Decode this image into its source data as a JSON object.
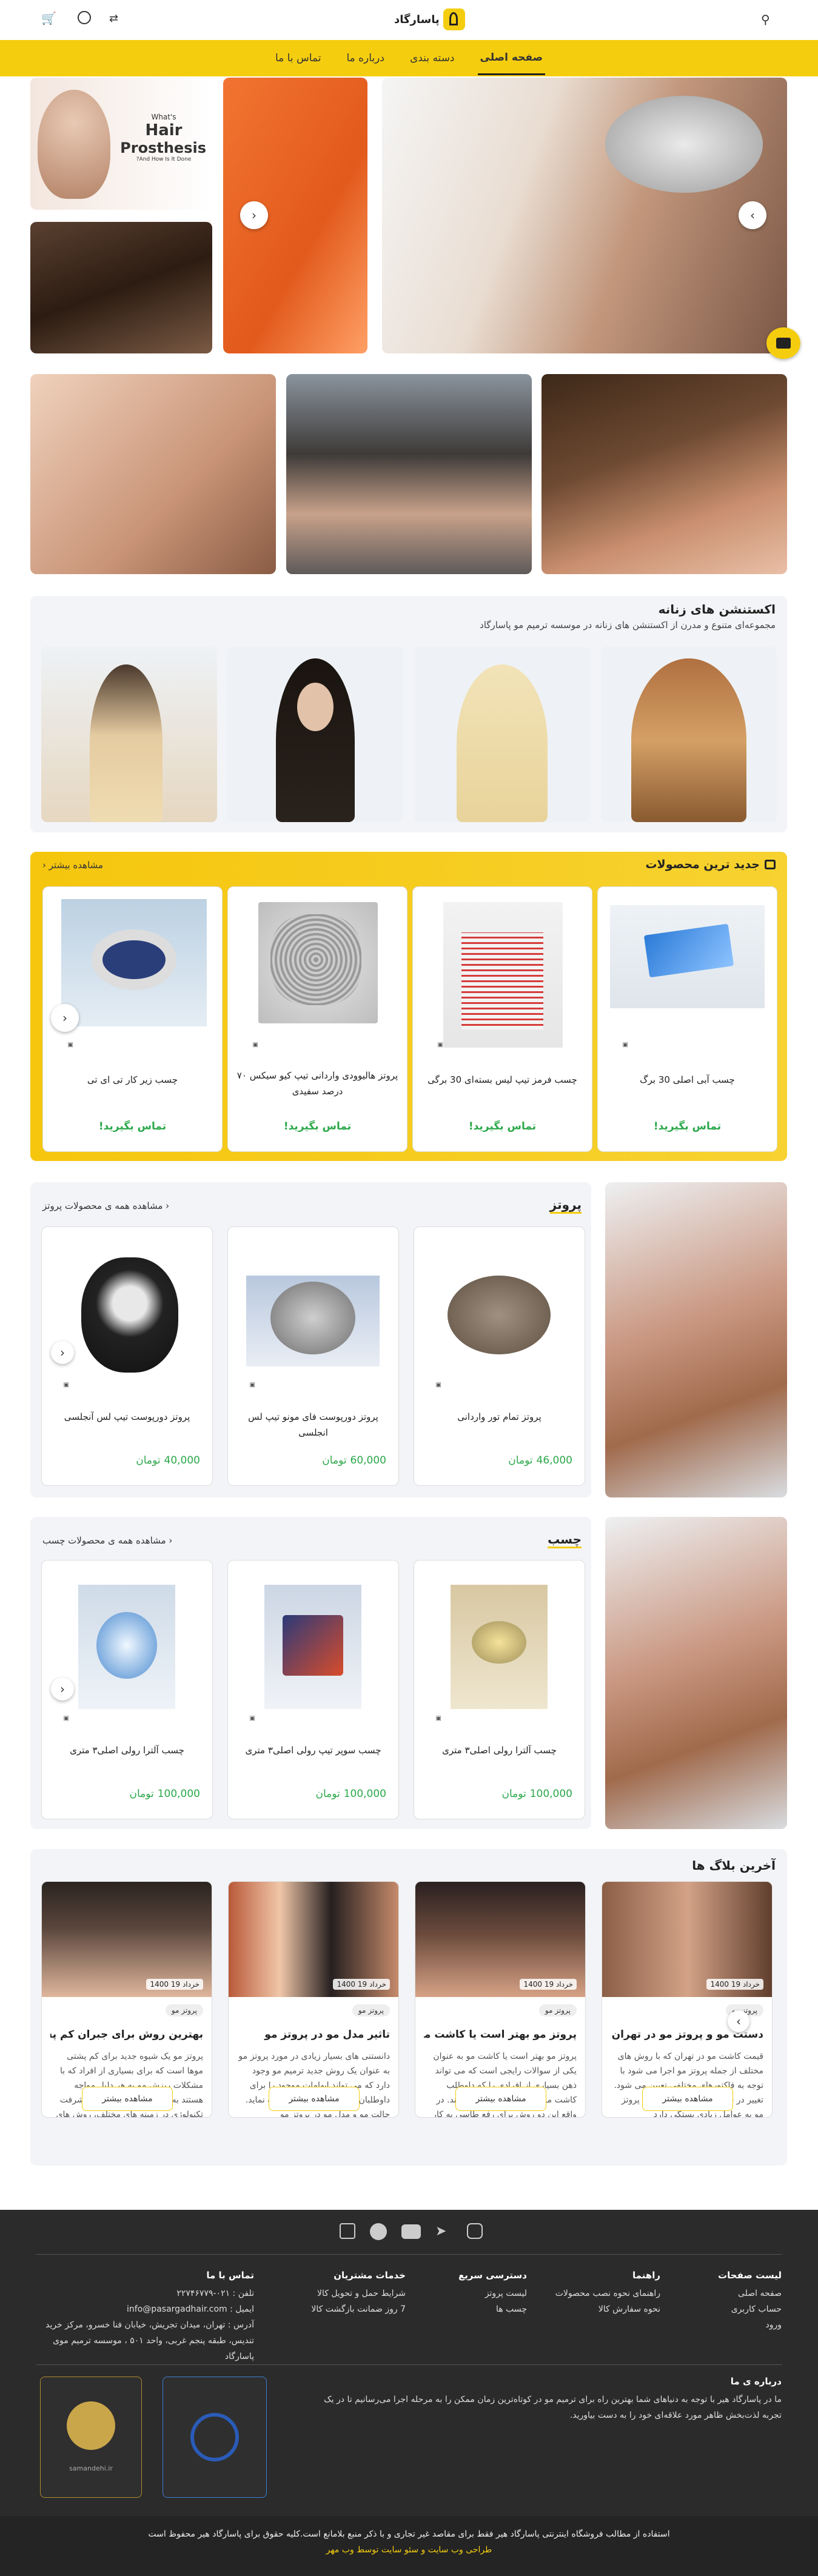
{
  "header": {
    "logo_text": "پاسارگاد",
    "search_icon": "search-icon",
    "cart_icon": "cart-icon",
    "user_icon": "user-icon",
    "compare_icon": "compare-icon"
  },
  "nav": {
    "items": [
      {
        "label": "صفحه اصلی"
      },
      {
        "label": "دسته بندی"
      },
      {
        "label": "درباره ما"
      },
      {
        "label": "تماس با ما"
      }
    ]
  },
  "hero": {
    "prosthesis_text": {
      "line1": "What's",
      "line2": "Hair",
      "line3": "Prosthesis",
      "line4": "And How Is It Done?"
    },
    "next_arrow": "›",
    "prev_arrow": "‹"
  },
  "extensions": {
    "title": "اکستنشن های زنانه",
    "subtitle": "مجموعه‌ای متنوع و مدرن از اکستنشن های زنانه در موسسه ترمیم مو پاسارگاد"
  },
  "new_products": {
    "title": "جدید ترین محصولات",
    "more": "مشاهده بیشتر",
    "items": [
      {
        "title": "چسب آبی اصلی 30 برگ",
        "cta": "تماس بگیرید!"
      },
      {
        "title": "چسب فرمز تیپ لیس بسته‌ای 30 برگی",
        "cta": "تماس بگیرید!"
      },
      {
        "title": "پروتز هالیوودی واردانی تیپ کیو سیکس ۷۰ درصد سفیدی",
        "cta": "تماس بگیرید!"
      },
      {
        "title": "چسب زیر کار تی ای تی",
        "cta": "تماس بگیرید!"
      }
    ]
  },
  "prosthesis": {
    "title": "پروتز",
    "more": "مشاهده همه ی محصولات پروتز",
    "currency": "تومان",
    "items": [
      {
        "title": "پروتز تمام تور واردانی",
        "price": "46,000"
      },
      {
        "title": "پروتز دورپوست فای مونو تیپ لس انجلسی",
        "price": "60,000"
      },
      {
        "title": "پروتز دورپوست تیپ لس آنجلسی",
        "price": "40,000"
      }
    ]
  },
  "glue": {
    "title": "چسب",
    "more": "مشاهده همه ی محصولات چسب",
    "currency": "تومان",
    "items": [
      {
        "title": "چسب آلترا رولی اصلی۳ متری",
        "price": "100,000"
      },
      {
        "title": "چسب سوپر تیپ رولی اصلی۳ متری",
        "price": "100,000"
      },
      {
        "title": "چسب آلترا رولی اصلی۳ متری",
        "price": "100,000"
      }
    ]
  },
  "blog": {
    "title": "آخرین بلاگ ها",
    "more": "مشاهده بیشتر",
    "posts": [
      {
        "tag": "پروتز مو",
        "date": "خرداد 19 1400",
        "title": "دستت مو و پروتز مو در تهران",
        "excerpt": "قیمت کاشت مو در تهران که با روش های مختلف از جمله پروتز مو اجرا می شود با توجه به فاکتورهای مختلفی تعیین می شود. تغییر در قیمت های تمام شده برای پروتز مو به عوامل زیادی بستگی دارد"
      },
      {
        "tag": "پروتز مو",
        "date": "خرداد 19 1400",
        "title": "پروتز مو بهتر است یا کاشت مو؟",
        "excerpt": "پروتز مو بهتر است یا کاشت مو به عنوان یکی از سوالات رایجی است که می تواند ذهن بسیاری از افرادی را که داوطلب کاشت مو هستند به خود مشغول کند. در واقع این دو روش برای رفع طاسی به کار می روند"
      },
      {
        "tag": "پروتز مو",
        "date": "خرداد 19 1400",
        "title": "تاثیر مدل مو در پروتز مو",
        "excerpt": "دانستنی های بسیار زیادی در مورد پروتز مو به عنوان یک روش جدید ترمیم مو وجود دارد که می تواند ابهامات موجود را برای داوطلبان انتخاب این روش برطرف نماید. حالت مو و مدل مو در پروتز مو"
      },
      {
        "tag": "پروتز مو",
        "date": "خرداد 19 1400",
        "title": "بهترین روش برای جبران کم پشتی موها",
        "excerpt": "پروتز مو یک شیوه جدید برای کم پشتی موها است که برای بسیاری از افراد که با مشکلات ریزش مو به هر دلیل مواجه هستند به کار می رود. امروزه با پیشرفت تکنولوژی در زمینه های مختلف، روش های ترمیم مو"
      }
    ]
  },
  "footer": {
    "social": [
      "instagram-icon",
      "telegram-icon",
      "youtube-icon",
      "facebook-icon",
      "aparat-icon"
    ],
    "cols": [
      {
        "title": "لیست صفحات",
        "items": [
          "صفحه اصلی",
          "حساب کاربری",
          "ورود"
        ]
      },
      {
        "title": "راهنما",
        "items": [
          "راهنمای نحوه نصب محصولات",
          "نحوه سفارش کالا"
        ]
      },
      {
        "title": "دسترسی سریع",
        "items": [
          "لیست پروتز",
          "چسب ها"
        ]
      },
      {
        "title": "خدمات مشتریان",
        "items": [
          "شرایط حمل و تحویل کالا",
          "7 روز ضمانت بازگشت کالا"
        ]
      }
    ],
    "contact_title": "تماس با ما",
    "phone": "تلفن : ۰۲۱-۲۲۷۴۶۷۷۹",
    "email": "ایمیل : info@pasargadhair.com",
    "address": "آدرس : تهران، میدان تجریش، خیابان فنا خسرو، مرکز خرید تندیس، طبقه پنجم غربی، واحد ۵۰۱ ، موسسه ترمیم موی پاسارگاد",
    "about_title": "درباره ی ما",
    "about": "ما در پاسارگاد هیر با توجه به دنیاهای شما بهترین راه برای ترمیم مو در کوتاه‌ترین زمان ممکن را به مرحله اجرا می‌رسانیم تا در یک تجربه لذت‌بخش ظاهر مورد علاقه‌ای خود را به دست بیاورید.",
    "badge2_label": "samandehi.ir",
    "copyright": "استفاده از مطالب فروشگاه اینترنتی پاسارگاد هیر فقط برای مقاصد غیر تجاری و با ذکر منبع بلامانع است.کلیه حقوق برای پاسارگاد هیر محفوظ است",
    "credit": "طراحی وب سایت و سئو سایت توسط وب مهر"
  },
  "colors": {
    "accent": "#f5cd0f",
    "price": "#2ba84a",
    "footer": "#2b2b2b"
  }
}
